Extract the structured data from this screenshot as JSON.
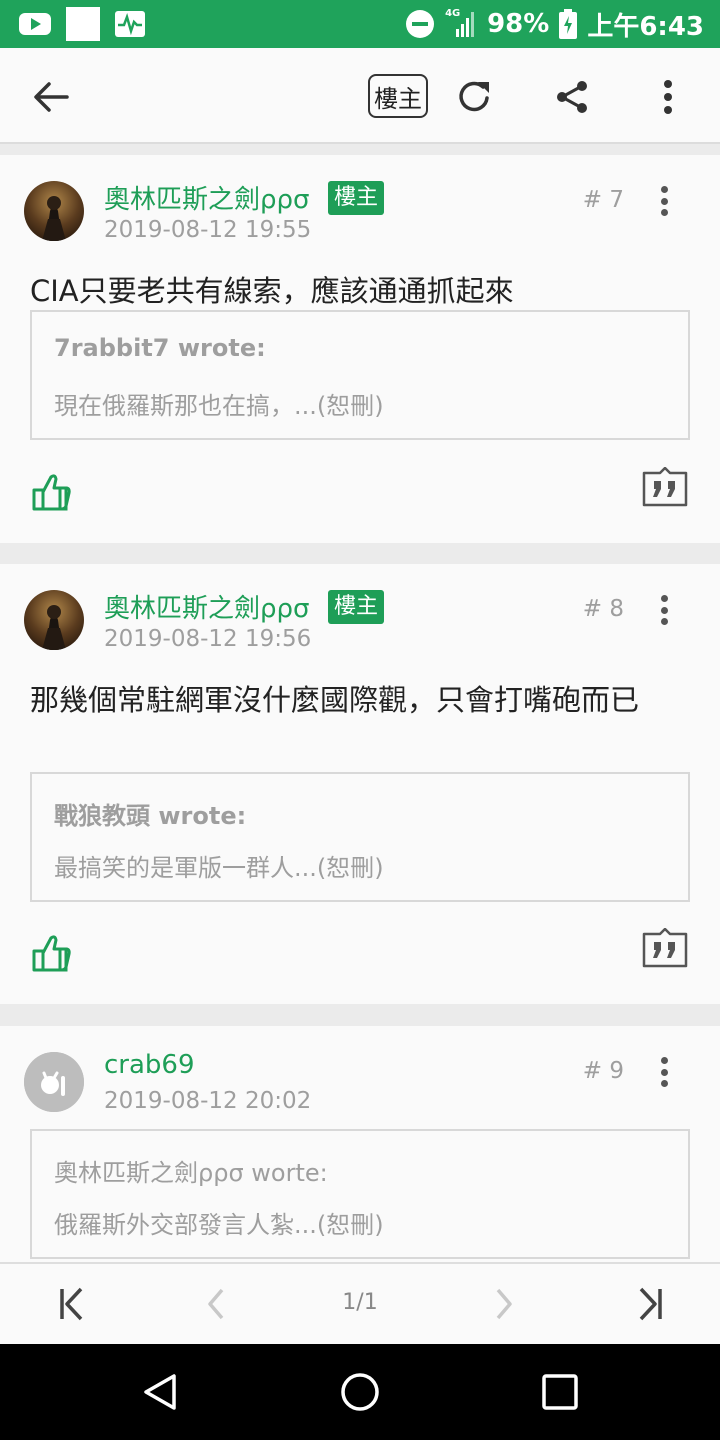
{
  "status_bar": {
    "network": "4G",
    "battery": "98%",
    "time": "上午6:43"
  },
  "toolbar": {
    "op_filter_label": "樓主"
  },
  "posts": [
    {
      "author": "奧林匹斯之劍ρρσ",
      "badge": "樓主",
      "time": "2019-08-12 19:55",
      "floor": "# 7",
      "text": "CIA只要老共有線索，應該通通抓起來",
      "quote": {
        "author": "7rabbit7 wrote:",
        "text": "現在俄羅斯那也在搞，...(恕刪)"
      }
    },
    {
      "author": "奧林匹斯之劍ρρσ",
      "badge": "樓主",
      "time": "2019-08-12 19:56",
      "floor": "# 8",
      "text": "那幾個常駐網軍沒什麼國際觀，只會打嘴砲而已",
      "quote": {
        "author": "戰狼教頭 wrote:",
        "text": "最搞笑的是軍版一群人...(恕刪)"
      }
    },
    {
      "author": "crab69",
      "time": "2019-08-12 20:02",
      "floor": "# 9",
      "quote": {
        "author": "奧林匹斯之劍ρρσ worte:",
        "text": "俄羅斯外交部發言人紮...(恕刪)"
      }
    }
  ],
  "pager": {
    "page_label": "1/1"
  },
  "colors": {
    "status_bar": "#1fa35b",
    "accent": "#1e9e57",
    "muted_text": "#9e9e9e",
    "background": "#ebebeb"
  },
  "icons": [
    "youtube-icon",
    "square-icon",
    "activity-icon",
    "do-not-disturb-icon",
    "signal-icon",
    "battery-icon",
    "back-arrow-icon",
    "refresh-icon",
    "share-icon",
    "more-vert-icon",
    "thumbs-up-icon",
    "quote-icon",
    "first-page-icon",
    "prev-page-icon",
    "next-page-icon",
    "last-page-icon",
    "nav-back-icon",
    "nav-home-icon",
    "nav-recents-icon"
  ]
}
